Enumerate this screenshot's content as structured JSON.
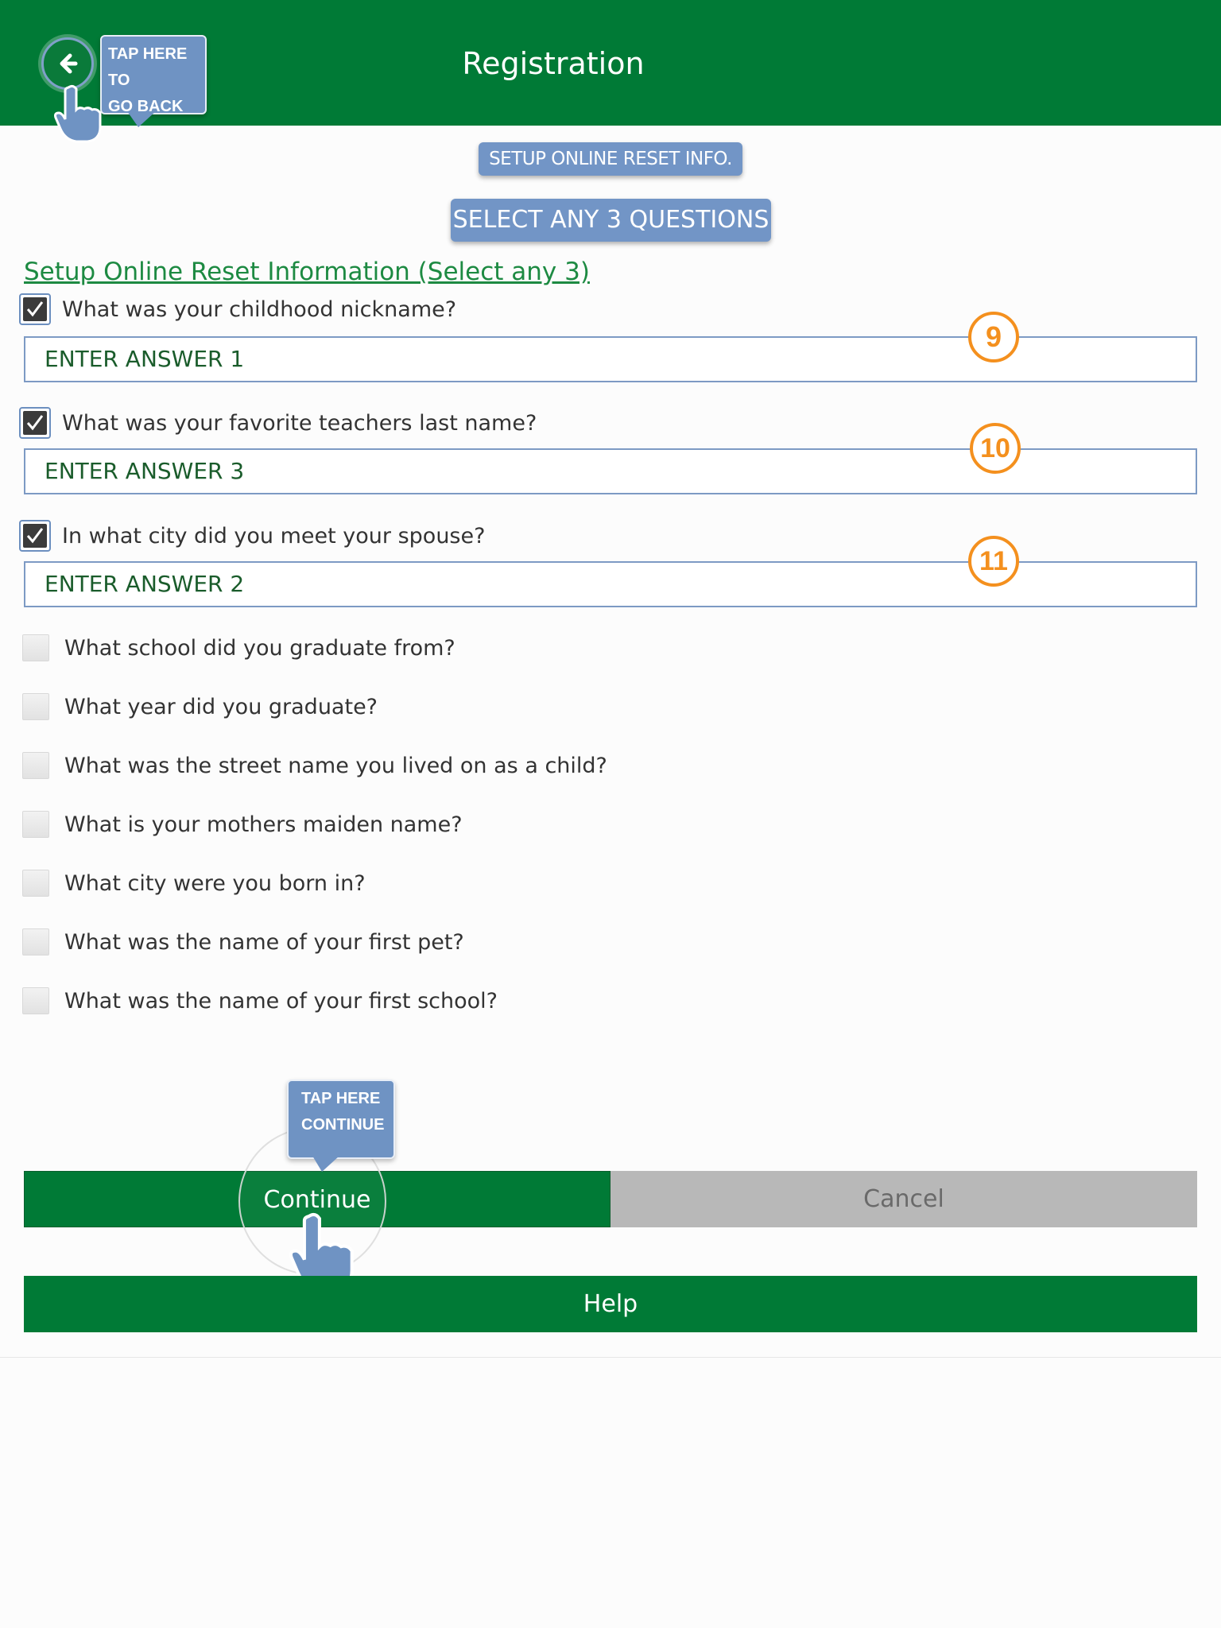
{
  "header": {
    "title": "Registration",
    "back_callout_line1": "TAP HERE TO",
    "back_callout_line2": "GO BACK"
  },
  "labels": {
    "setup_pill": "SETUP ONLINE RESET INFO.",
    "select_pill": "SELECT ANY 3 QUESTIONS",
    "section_title": "Setup Online Reset Information (Select any 3)"
  },
  "selected_questions": [
    {
      "question": "What was your childhood nickname?",
      "answer_placeholder": "ENTER ANSWER 1",
      "badge": "9",
      "checked": true
    },
    {
      "question": "What was your favorite teachers last name?",
      "answer_placeholder": "ENTER ANSWER 3",
      "badge": "10",
      "checked": true
    },
    {
      "question": "In what city did you meet your spouse?",
      "answer_placeholder": "ENTER ANSWER 2",
      "badge": "11",
      "checked": true
    }
  ],
  "other_questions": [
    {
      "question": "What school did you graduate from?",
      "checked": false
    },
    {
      "question": "What year did you graduate?",
      "checked": false
    },
    {
      "question": "What was the street name you lived on as a child?",
      "checked": false
    },
    {
      "question": "What is your mothers maiden name?",
      "checked": false
    },
    {
      "question": "What city were you born in?",
      "checked": false
    },
    {
      "question": "What was the name of your first pet?",
      "checked": false
    },
    {
      "question": "What was the name of your first school?",
      "checked": false
    }
  ],
  "buttons": {
    "continue": "Continue",
    "cancel": "Cancel",
    "help": "Help",
    "continue_callout_line1": "TAP HERE",
    "continue_callout_line2": "CONTINUE"
  },
  "colors": {
    "brand_green": "#007a36",
    "callout_blue": "#7295c6",
    "badge_orange": "#f4901e",
    "cancel_gray": "#b8b8b8"
  },
  "icons": {
    "back": "arrow-left-icon",
    "pointer": "hand-pointer-icon",
    "check": "checkmark-icon"
  }
}
